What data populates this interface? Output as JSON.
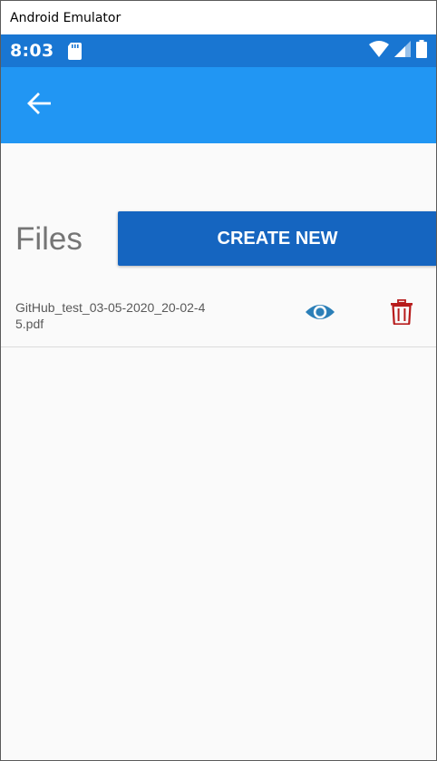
{
  "window": {
    "title": "Android Emulator"
  },
  "status_bar": {
    "time": "8:03",
    "icons": [
      "sd-card-icon",
      "wifi-icon",
      "signal-icon",
      "battery-icon"
    ]
  },
  "app_bar": {
    "back_icon": "arrow-back-icon",
    "color": "#2196f3"
  },
  "page": {
    "title": "Files",
    "create_button_label": "CREATE NEW",
    "accent": "#1565c0"
  },
  "files": [
    {
      "name": "GitHub_test_03-05-2020_20-02-45.pdf",
      "view_icon": "eye-icon",
      "delete_icon": "trash-icon"
    }
  ]
}
